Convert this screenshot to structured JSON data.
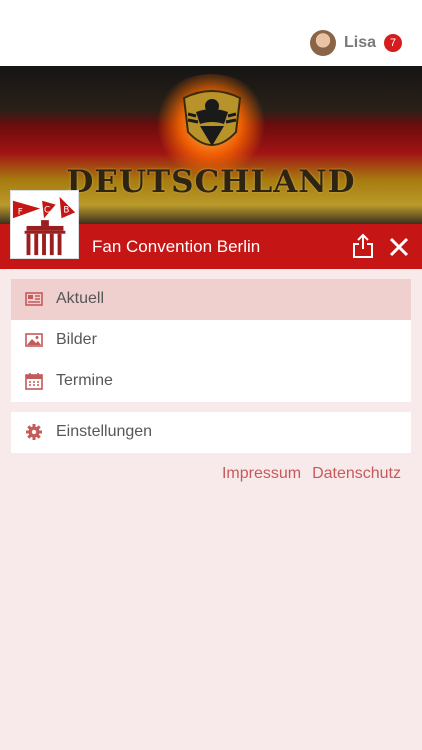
{
  "user": {
    "name": "Lisa",
    "badge": "7"
  },
  "banner": {
    "text": "DEUTSCHLAND"
  },
  "app": {
    "title": "Fan Convention Berlin",
    "logo_letters": [
      "F",
      "C",
      "B"
    ]
  },
  "menu": [
    {
      "label": "Aktuell",
      "icon": "newspaper-icon",
      "active": true
    },
    {
      "label": "Bilder",
      "icon": "image-icon",
      "active": false
    },
    {
      "label": "Termine",
      "icon": "calendar-icon",
      "active": false
    }
  ],
  "settings": {
    "label": "Einstellungen",
    "icon": "gear-icon"
  },
  "links": {
    "impressum": "Impressum",
    "datenschutz": "Datenschutz"
  },
  "colors": {
    "accent": "#c51515",
    "background": "#f8eaea",
    "link": "#c55a5a",
    "active_row": "#f0cfcf"
  }
}
